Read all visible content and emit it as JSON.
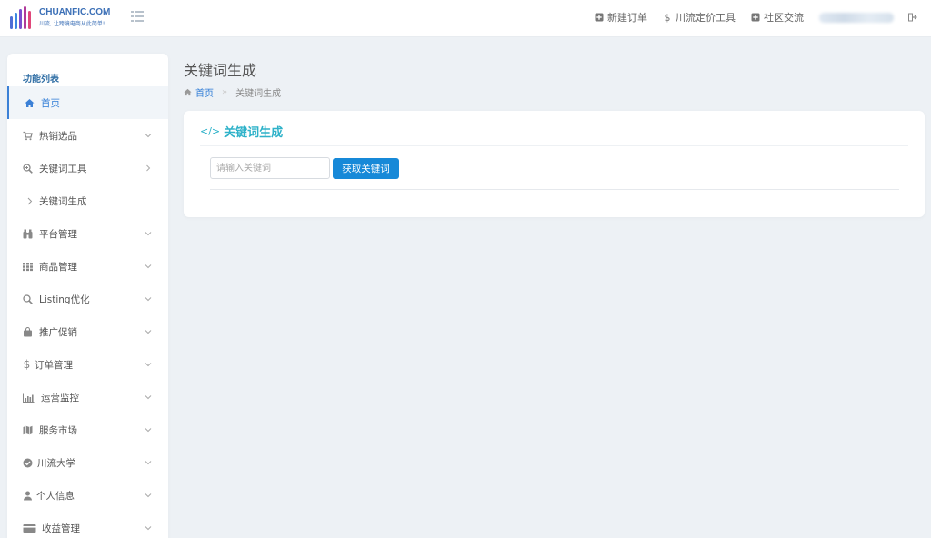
{
  "brand": {
    "name": "CHUANFIC.COM",
    "slogan": "川流, 让跨境电商从此简单!"
  },
  "header": {
    "links": [
      {
        "label": "新建订单",
        "icon": "plus-square-icon"
      },
      {
        "label": "川流定价工具",
        "icon": "dollar-icon"
      },
      {
        "label": "社区交流",
        "icon": "plus-square-icon"
      }
    ]
  },
  "sidebar": {
    "title": "功能列表",
    "items": [
      {
        "label": "首页",
        "icon": "home-icon",
        "active": true
      },
      {
        "label": "热销选品",
        "icon": "cart-icon",
        "chevron": "down"
      },
      {
        "label": "关键词工具",
        "icon": "search-plus-icon",
        "chevron": "right"
      },
      {
        "label": "关键词生成",
        "icon": "chevron-right-icon",
        "sub": true
      },
      {
        "label": "平台管理",
        "icon": "binoculars-icon",
        "chevron": "down"
      },
      {
        "label": "商品管理",
        "icon": "grid-icon",
        "chevron": "down"
      },
      {
        "label": "Listing优化",
        "icon": "search-icon",
        "chevron": "down"
      },
      {
        "label": "推广促销",
        "icon": "shopping-bag-icon",
        "chevron": "down"
      },
      {
        "label": "订单管理",
        "icon": "dollar-icon",
        "chevron": "down"
      },
      {
        "label": "运营监控",
        "icon": "bar-chart-icon",
        "chevron": "down"
      },
      {
        "label": "服务市场",
        "icon": "map-icon",
        "chevron": "down"
      },
      {
        "label": "川流大学",
        "icon": "check-circle-icon",
        "chevron": "down"
      },
      {
        "label": "个人信息",
        "icon": "user-icon",
        "chevron": "down"
      },
      {
        "label": "收益管理",
        "icon": "credit-card-icon",
        "chevron": "down"
      }
    ]
  },
  "main": {
    "title": "关键词生成",
    "breadcrumb": {
      "home": "首页",
      "current": "关键词生成"
    },
    "card": {
      "title": "关键词生成",
      "input_placeholder": "请输入关键词",
      "input_value": "",
      "button_label": "获取关键词"
    }
  },
  "colors": {
    "accent": "#1789d8",
    "card_title": "#2fb2c9",
    "background": "#edf1f5"
  }
}
